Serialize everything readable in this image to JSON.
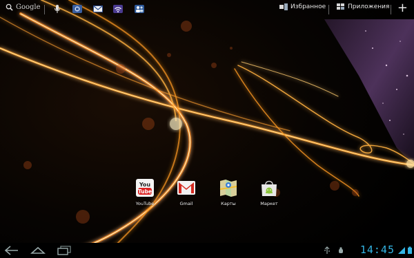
{
  "search": {
    "label": "Google"
  },
  "top_right": {
    "favorites_label": "Избранное",
    "apps_label": "Приложения",
    "add_label": "+"
  },
  "apps": [
    {
      "label": "YouTube",
      "icon": "youtube-icon"
    },
    {
      "label": "Gmail",
      "icon": "gmail-icon"
    },
    {
      "label": "Карты",
      "icon": "maps-icon"
    },
    {
      "label": "Маркет",
      "icon": "market-icon"
    }
  ],
  "status": {
    "time": "14:45"
  },
  "colors": {
    "accent": "#33b5e5",
    "glow": "#ffb030"
  }
}
